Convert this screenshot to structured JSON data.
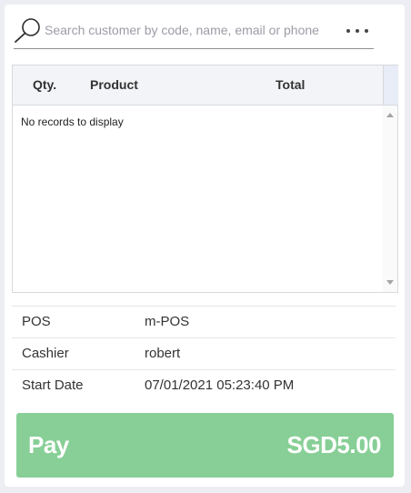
{
  "search": {
    "placeholder": "Search customer by code, name, email or phone",
    "icon": "search-icon",
    "more_icon": "more-horizontal-icon"
  },
  "grid": {
    "columns": [
      "Qty.",
      "Product",
      "Total"
    ],
    "empty_message": "No records to display",
    "rows": []
  },
  "info": {
    "rows": [
      {
        "label": "POS",
        "value": "m-POS"
      },
      {
        "label": "Cashier",
        "value": "robert"
      },
      {
        "label": "Start Date",
        "value": "07/01/2021 05:23:40 PM"
      }
    ]
  },
  "pay": {
    "label": "Pay",
    "amount": "SGD5.00",
    "color": "#87cf96"
  }
}
